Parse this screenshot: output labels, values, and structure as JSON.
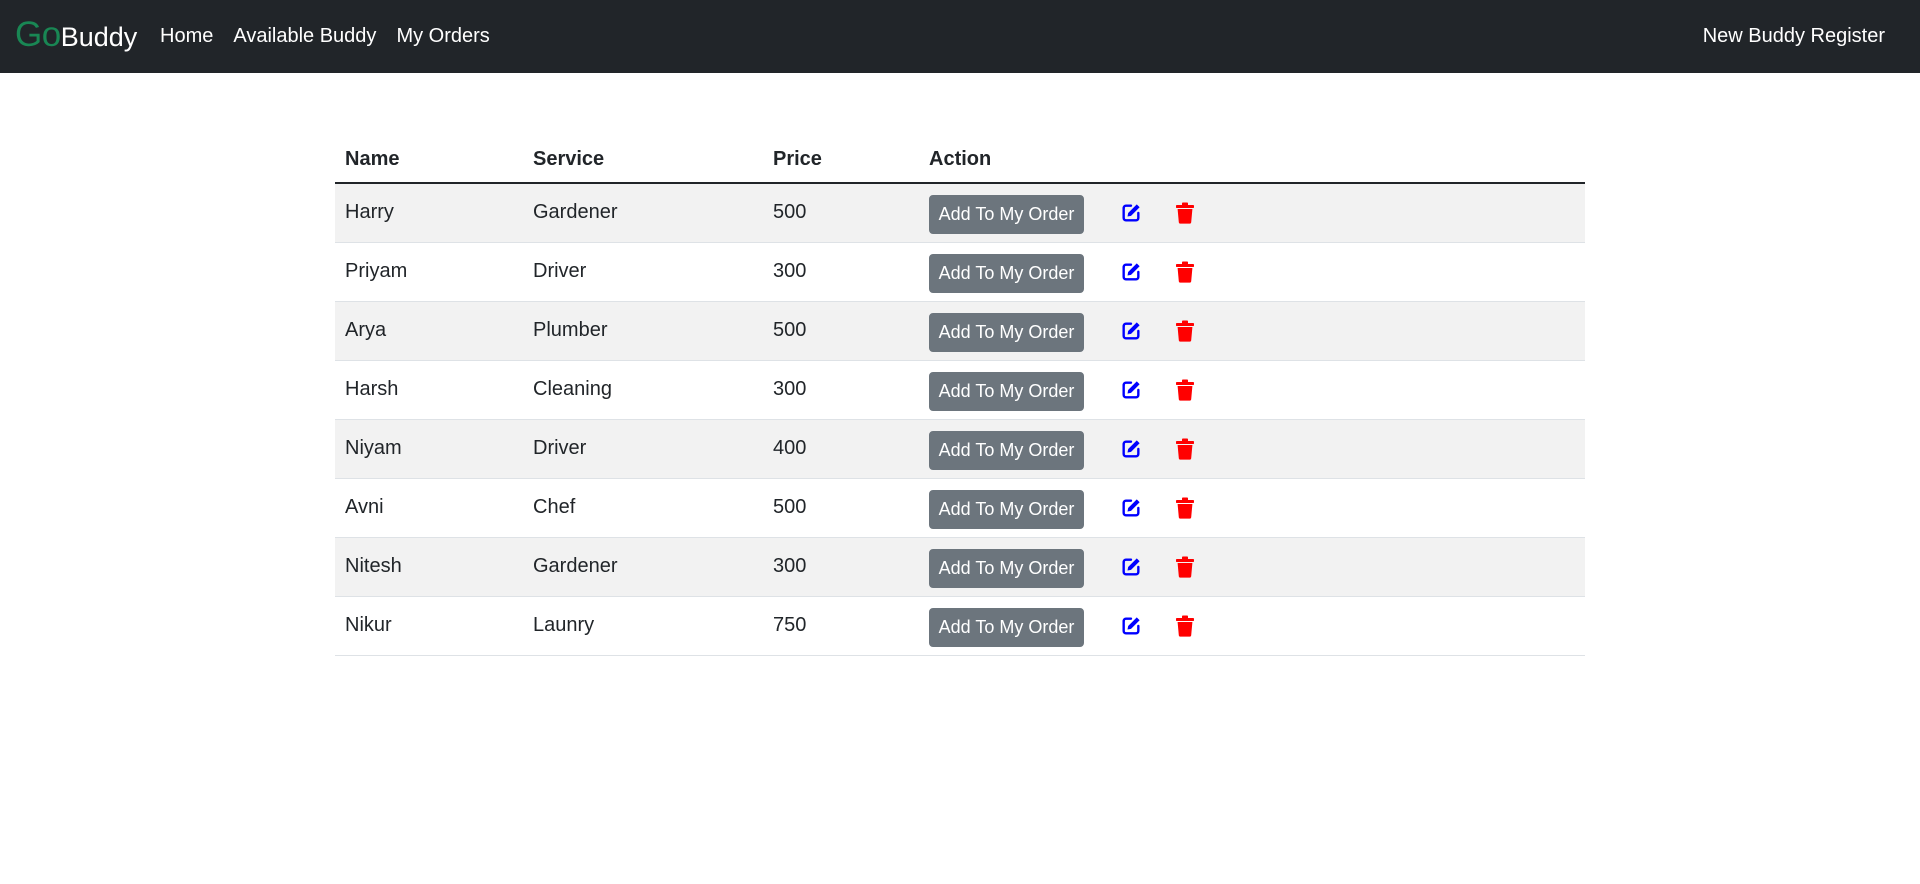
{
  "navbar": {
    "brand_go": "Go",
    "brand_buddy": "Buddy",
    "links": [
      "Home",
      "Available Buddy",
      "My Orders"
    ],
    "register_label": "New Buddy Register",
    "background": "#212529",
    "brand_color": "#198754"
  },
  "table": {
    "headers": [
      "Name",
      "Service",
      "Price",
      "Action"
    ],
    "add_button_label": "Add To My Order",
    "edit_icon": "edit-icon",
    "delete_icon": "trash-icon",
    "edit_color": "#0000ff",
    "delete_color": "#ff0000",
    "rows": [
      {
        "name": "Harry",
        "service": "Gardener",
        "price": "500"
      },
      {
        "name": "Priyam",
        "service": "Driver",
        "price": "300"
      },
      {
        "name": "Arya",
        "service": "Plumber",
        "price": "500"
      },
      {
        "name": "Harsh",
        "service": "Cleaning",
        "price": "300"
      },
      {
        "name": "Niyam",
        "service": "Driver",
        "price": "400"
      },
      {
        "name": "Avni",
        "service": "Chef",
        "price": "500"
      },
      {
        "name": "Nitesh",
        "service": "Gardener",
        "price": "300"
      },
      {
        "name": "Nikur",
        "service": "Launry",
        "price": "750"
      }
    ]
  }
}
